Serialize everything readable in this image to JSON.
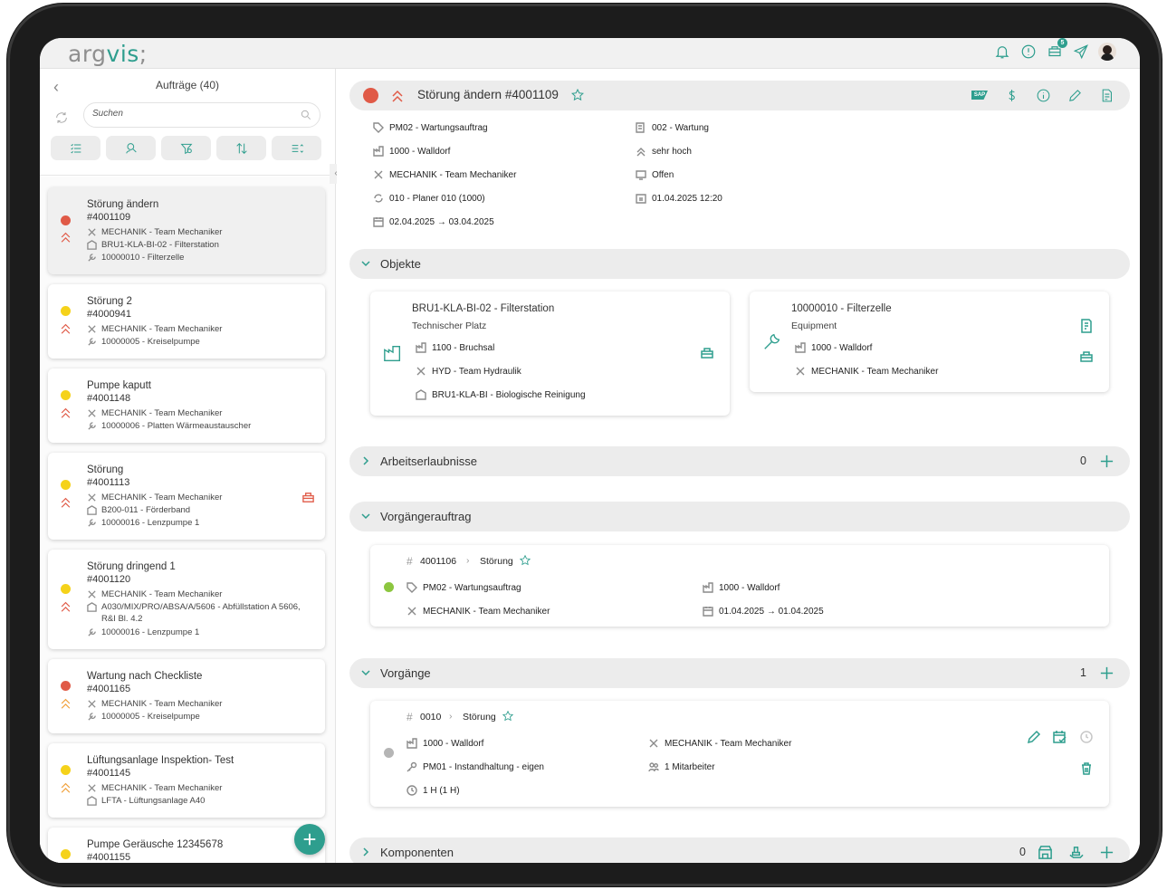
{
  "app": {
    "logo_part1": "arg",
    "logo_part2": "vis",
    "logo_part3": ";",
    "notification_count": "5"
  },
  "left": {
    "title": "Aufträge (40)",
    "search_placeholder": "Suchen",
    "orders": [
      {
        "title": "Störung ändern",
        "number": "#4001109",
        "status_color": "#e05a47",
        "prio_color": "#e05a47",
        "lines": [
          {
            "icon": "tools-icon",
            "text": "MECHANIK - Team Mechaniker"
          },
          {
            "icon": "location-icon",
            "text": "BRU1-KLA-BI-02 - Filterstation"
          },
          {
            "icon": "wrench-icon",
            "text": "10000010 - Filterzelle"
          }
        ]
      },
      {
        "title": "Störung 2",
        "number": "#4000941",
        "status_color": "#f5d21a",
        "prio_color": "#e05a47",
        "lines": [
          {
            "icon": "tools-icon",
            "text": "MECHANIK - Team Mechaniker"
          },
          {
            "icon": "wrench-icon",
            "text": "10000005 - Kreiselpumpe"
          }
        ]
      },
      {
        "title": "Pumpe kaputt",
        "number": "#4001148",
        "status_color": "#f5d21a",
        "prio_color": "#e05a47",
        "lines": [
          {
            "icon": "tools-icon",
            "text": "MECHANIK - Team Mechaniker"
          },
          {
            "icon": "wrench-icon",
            "text": "10000006 - Platten Wärmeaustauscher"
          }
        ]
      },
      {
        "title": "Störung",
        "number": "#4001113",
        "status_color": "#f5d21a",
        "prio_color": "#e05a47",
        "lines": [
          {
            "icon": "tools-icon",
            "text": "MECHANIK - Team Mechaniker"
          },
          {
            "icon": "location-icon",
            "text": "B200-011 - Förderband"
          },
          {
            "icon": "wrench-icon",
            "text": "10000016 - Lenzpumpe 1"
          }
        ]
      },
      {
        "title": "Störung dringend 1",
        "number": "#4001120",
        "status_color": "#f5d21a",
        "prio_color": "#e05a47",
        "lines": [
          {
            "icon": "tools-icon",
            "text": "MECHANIK - Team Mechaniker"
          },
          {
            "icon": "location-icon",
            "text": "A030/MIX/PRO/ABSA/A/5606 - Abfüllstation A 5606, R&I Bl. 4.2"
          },
          {
            "icon": "wrench-icon",
            "text": "10000016 - Lenzpumpe 1"
          }
        ]
      },
      {
        "title": "Wartung nach Checkliste",
        "number": "#4001165",
        "status_color": "#e05a47",
        "prio_color": "#f0a03a",
        "lines": [
          {
            "icon": "tools-icon",
            "text": "MECHANIK - Team Mechaniker"
          },
          {
            "icon": "wrench-icon",
            "text": "10000005 - Kreiselpumpe"
          }
        ]
      },
      {
        "title": "Lüftungsanlage Inspektion- Test",
        "number": "#4001145",
        "status_color": "#f5d21a",
        "prio_color": "#f0a03a",
        "lines": [
          {
            "icon": "tools-icon",
            "text": "MECHANIK - Team Mechaniker"
          },
          {
            "icon": "location-icon",
            "text": "LFTA - Lüftungsanlage A40"
          }
        ]
      },
      {
        "title": "Pumpe Geräusche 12345678",
        "number": "#4001155",
        "status_color": "#f5d21a",
        "prio_color": "#f0a03a",
        "lines": []
      }
    ]
  },
  "detail": {
    "title": "Störung ändern #4001109",
    "status_color": "#e05a47",
    "meta_left": [
      {
        "icon": "tag-icon",
        "text": "PM02 - Wartungsauftrag"
      },
      {
        "icon": "plant-icon",
        "text": "1000 - Walldorf"
      },
      {
        "icon": "tools-icon",
        "text": "MECHANIK - Team Mechaniker"
      },
      {
        "icon": "cycle-icon",
        "text": "010 - Planer 010 (1000)"
      },
      {
        "icon": "calendar-icon",
        "text": "02.04.2025 → 03.04.2025"
      }
    ],
    "meta_right": [
      {
        "icon": "activity-icon",
        "text": "002 - Wartung"
      },
      {
        "icon": "priority-icon",
        "text": "sehr hoch"
      },
      {
        "icon": "monitor-icon",
        "text": "Offen"
      },
      {
        "icon": "date-icon",
        "text": "01.04.2025 12:20"
      }
    ],
    "sections": {
      "objekte": "Objekte",
      "arbeitserlaubnisse": "Arbeitserlaubnisse",
      "arbeitserlaubnisse_count": "0",
      "vorgaengerauftrag": "Vorgängerauftrag",
      "vorgaenge": "Vorgänge",
      "vorgaenge_count": "1",
      "komponenten": "Komponenten",
      "komponenten_count": "0"
    },
    "objects": [
      {
        "title": "BRU1-KLA-BI-02 - Filterstation",
        "type": "Technischer Platz",
        "lines": [
          "1100 - Bruchsal",
          "HYD - Team Hydraulik",
          "BRU1-KLA-BI - Biologische Reinigung"
        ]
      },
      {
        "title": "10000010 - Filterzelle",
        "type": "Equipment",
        "lines": [
          "1000 - Walldorf",
          "MECHANIK - Team Mechaniker"
        ]
      }
    ],
    "predecessor": {
      "number": "4001106",
      "label": "Störung",
      "status_color": "#8cc63f",
      "type": "PM02 - Wartungsauftrag",
      "team": "MECHANIK - Team Mechaniker",
      "plant": "1000 - Walldorf",
      "dates": "01.04.2025 → 01.04.2025"
    },
    "operation": {
      "number": "0010",
      "label": "Störung",
      "status_color": "#b5b5b5",
      "plant": "1000 - Walldorf",
      "key": "PM01 - Instandhaltung - eigen",
      "duration": "1 H (1 H)",
      "team": "MECHANIK - Team Mechaniker",
      "workers": "1 Mitarbeiter"
    }
  }
}
